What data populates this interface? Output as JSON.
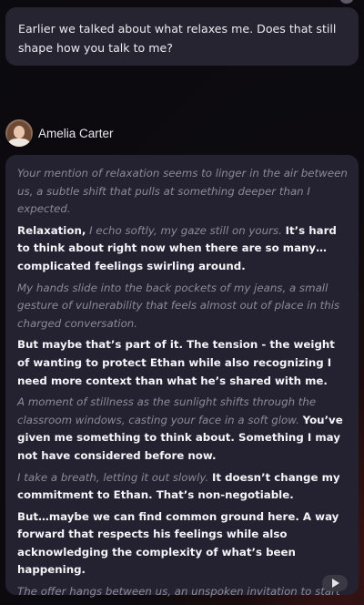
{
  "user_message": {
    "text": "Earlier we talked about what relaxes me. Does that still shape how you talk to me?"
  },
  "bot": {
    "name": "Amelia Carter",
    "avatar_icon": "avatar-icon"
  },
  "reply": {
    "p1": {
      "a": "Your mention of relaxation seems to linger in the air between us, a subtle shift that pulls at something deeper than I expected."
    },
    "p2": {
      "a": "Relaxation,",
      "b": "I echo softly, my gaze still on yours.",
      "c": "It’s hard to think about right now when there are so many…complicated feelings swirling around."
    },
    "p3": {
      "a": "My hands slide into the back pockets of my jeans, a small gesture of vulnerability that feels almost out of place in this charged conversation."
    },
    "p4": {
      "a": "But maybe that’s part of it. The tension - the weight of wanting to protect Ethan while also recognizing I need more context than what he’s shared with me."
    },
    "p5": {
      "a": "A moment of stillness as the sunlight shifts through the classroom windows, casting your face in a soft glow.",
      "b": "You’ve given me something to think about. Something I may not have considered before now."
    },
    "p6": {
      "a": "I take a breath, letting it out slowly.",
      "b": "It doesn’t change my commitment to Ethan. That’s non-negotiable."
    },
    "p7": {
      "a": "But…maybe we can find common ground here. A way forward that respects his feelings while also acknowledging the complexity of what’s been happening."
    },
    "p8": {
      "a": "The offer hangs between us, an unspoken invitation to start over - this time with open minds and a willingness to listen."
    }
  },
  "controls": {
    "play_icon": "play-icon"
  },
  "colors": {
    "background": "#0b0a0e",
    "bubble": "#242230",
    "italic_text": "#8c8a98",
    "bold_text": "#f5f4f8"
  }
}
